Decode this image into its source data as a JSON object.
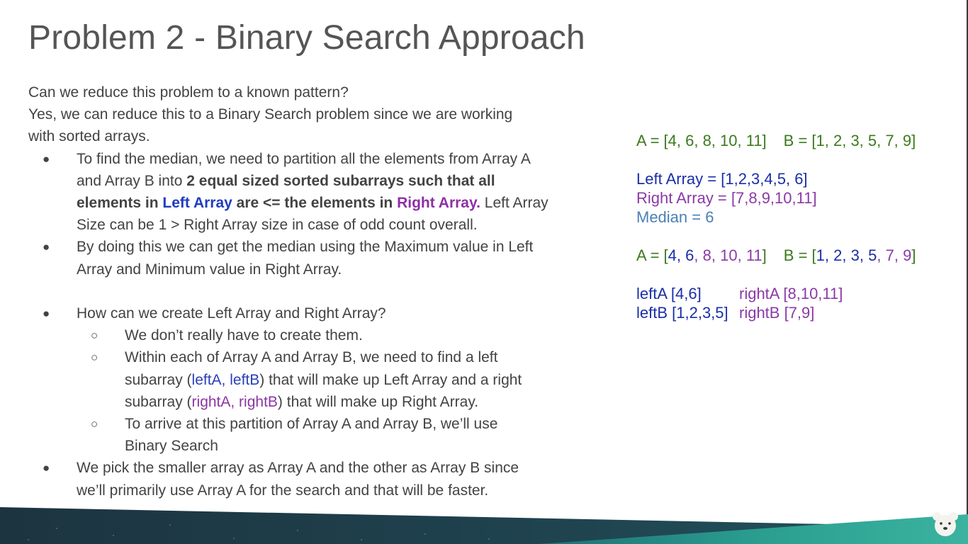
{
  "title": "Problem 2 - Binary Search Approach",
  "intro": {
    "line1": "Can we reduce this problem to a known pattern?",
    "line2": "Yes, we can reduce this to a Binary Search problem since we are working",
    "line3": "with sorted arrays."
  },
  "bullets": {
    "marker": "●",
    "sub_marker": "○",
    "b1": {
      "pre": "To find the median, we need to partition all the elements from Array A",
      "pre2": "and Array B into ",
      "bold1": "2 equal sized sorted subarrays such that all",
      "bold2": "elements in ",
      "left_array": "Left Array",
      "bold3": " are <= the elements in ",
      "right_array": "Right Array.",
      "post": " Left Array",
      "post2": "Size can be 1 > Right Array size in case of odd count overall."
    },
    "b2": {
      "l1": "By doing this we can get the median using the Maximum value in Left",
      "l2": "Array and Minimum value in Right Array."
    },
    "b3": {
      "text": "How can we create Left Array and Right Array?",
      "s1": "We don’t really have to create them.",
      "s2_l1": "Within each of Array A and Array B, we need to find a left",
      "s2_pre": "subarray (",
      "s2_left": "leftA, leftB",
      "s2_post": ") that will make up Left Array and a right",
      "s2_pre2": "subarray (",
      "s2_right": "rightA, rightB",
      "s2_post2": ") that will make up Right Array.",
      "s3_l1": "To arrive at this partition of Array A and Array B, we’ll use",
      "s3_l2": "Binary Search"
    },
    "b4": {
      "l1": "We pick the smaller array as Array A and the other as Array B since",
      "l2": "we’ll primarily use Array A for the search and that will be faster."
    }
  },
  "example": {
    "a_line": "A = [4, 6, 8, 10, 11]",
    "b_line": "B = [1, 2, 3, 5, 7, 9]",
    "left_array": "Left Array = [1,2,3,4,5, 6]",
    "right_array": "Right Array = [7,8,9,10,11]",
    "median": "Median =  6",
    "a2": {
      "open": "A = [",
      "v1": "4",
      "c1": ", ",
      "v2": "6",
      "c2": ", ",
      "v3": "8",
      "c3": ", ",
      "v4": "10",
      "c4": ", ",
      "v5": "11",
      "close": "]"
    },
    "b2": {
      "open": "B = [",
      "v1": "1",
      "c1": ", ",
      "v2": "2",
      "c2": ", ",
      "v3": "3",
      "c3": ", ",
      "v4": "5",
      "c4": ", ",
      "v5": "7",
      "c5": ", ",
      "v6": "9",
      "close": "]"
    },
    "leftA": "leftA [4,6]",
    "rightA": "rightA [8,10,11]",
    "leftB": "leftB [1,2,3,5]",
    "rightB": "rightB [7,9]"
  },
  "colors": {
    "title": "#555555",
    "body": "#434343",
    "left_highlight": "#1f3cc1",
    "right_highlight": "#8e2fa6",
    "example_green": "#3c7a1e",
    "example_navy": "#1a2fa8",
    "example_plum": "#8b3aa6",
    "median_blue": "#4a80b5",
    "footer_dark": "#1f3f4a",
    "footer_teal": "#2a9d8f"
  },
  "icons": {
    "logo": "bear-logo-icon"
  }
}
